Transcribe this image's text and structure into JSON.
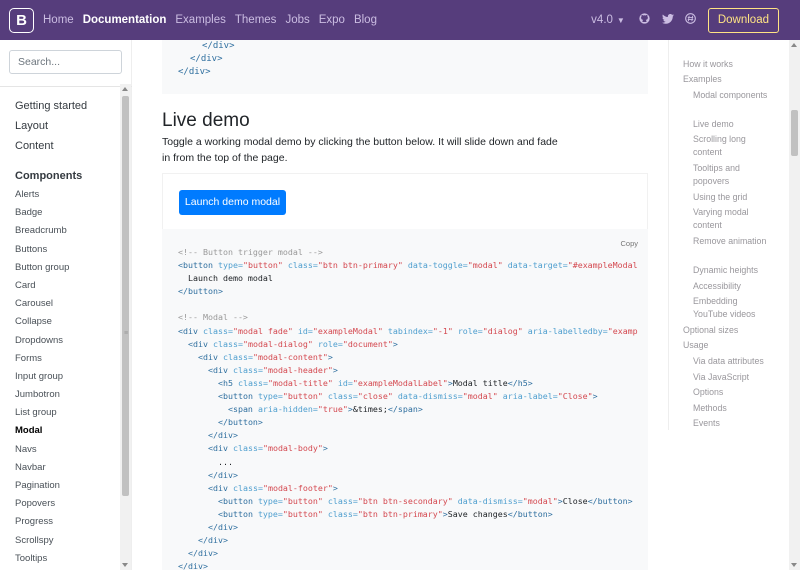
{
  "navbar": {
    "brand": "B",
    "links": [
      {
        "label": "Home",
        "active": false
      },
      {
        "label": "Documentation",
        "active": true
      },
      {
        "label": "Examples",
        "active": false
      },
      {
        "label": "Themes",
        "active": false
      },
      {
        "label": "Jobs",
        "active": false
      },
      {
        "label": "Expo",
        "active": false
      },
      {
        "label": "Blog",
        "active": false
      }
    ],
    "version": "v4.0",
    "icons": [
      "github-icon",
      "twitter-icon",
      "slack-icon"
    ],
    "download_label": "Download",
    "colors": {
      "background": "#563d7c",
      "download_accent": "#ffe484"
    }
  },
  "sidebar": {
    "search_placeholder": "Search...",
    "groups": [
      "Getting started",
      "Layout",
      "Content"
    ],
    "components_heading": "Components",
    "items": [
      "Alerts",
      "Badge",
      "Breadcrumb",
      "Buttons",
      "Button group",
      "Card",
      "Carousel",
      "Collapse",
      "Dropdowns",
      "Forms",
      "Input group",
      "Jumbotron",
      "List group",
      "Modal",
      "Navs",
      "Navbar",
      "Pagination",
      "Popovers",
      "Progress",
      "Scrollspy",
      "Tooltips"
    ],
    "active_item": "Modal"
  },
  "main": {
    "code_top": [
      "</div>",
      "</div>",
      "</div>"
    ],
    "section_title": "Live demo",
    "lead": "Toggle a working modal demo by clicking the button below. It will slide down and fade in from the top of the page.",
    "launch_button": "Launch demo modal",
    "primary_color": "#007bff",
    "copy_label": "Copy"
  },
  "toc": {
    "items": [
      {
        "label": "How it works",
        "level": 1
      },
      {
        "label": "Examples",
        "level": 1
      },
      {
        "label": "Modal components",
        "level": 2
      },
      {
        "label": "Live demo",
        "level": 2
      },
      {
        "label": "Scrolling long content",
        "level": 2
      },
      {
        "label": "Tooltips and popovers",
        "level": 2
      },
      {
        "label": "Using the grid",
        "level": 2
      },
      {
        "label": "Varying modal content",
        "level": 2
      },
      {
        "label": "Remove animation",
        "level": 2
      },
      {
        "label": "Dynamic heights",
        "level": 2
      },
      {
        "label": "Accessibility",
        "level": 2
      },
      {
        "label": "Embedding YouTube videos",
        "level": 2
      },
      {
        "label": "Optional sizes",
        "level": 1
      },
      {
        "label": "Usage",
        "level": 1
      },
      {
        "label": "Via data attributes",
        "level": 2
      },
      {
        "label": "Via JavaScript",
        "level": 2
      },
      {
        "label": "Options",
        "level": 2
      },
      {
        "label": "Methods",
        "level": 2
      },
      {
        "label": "Events",
        "level": 2
      }
    ]
  }
}
